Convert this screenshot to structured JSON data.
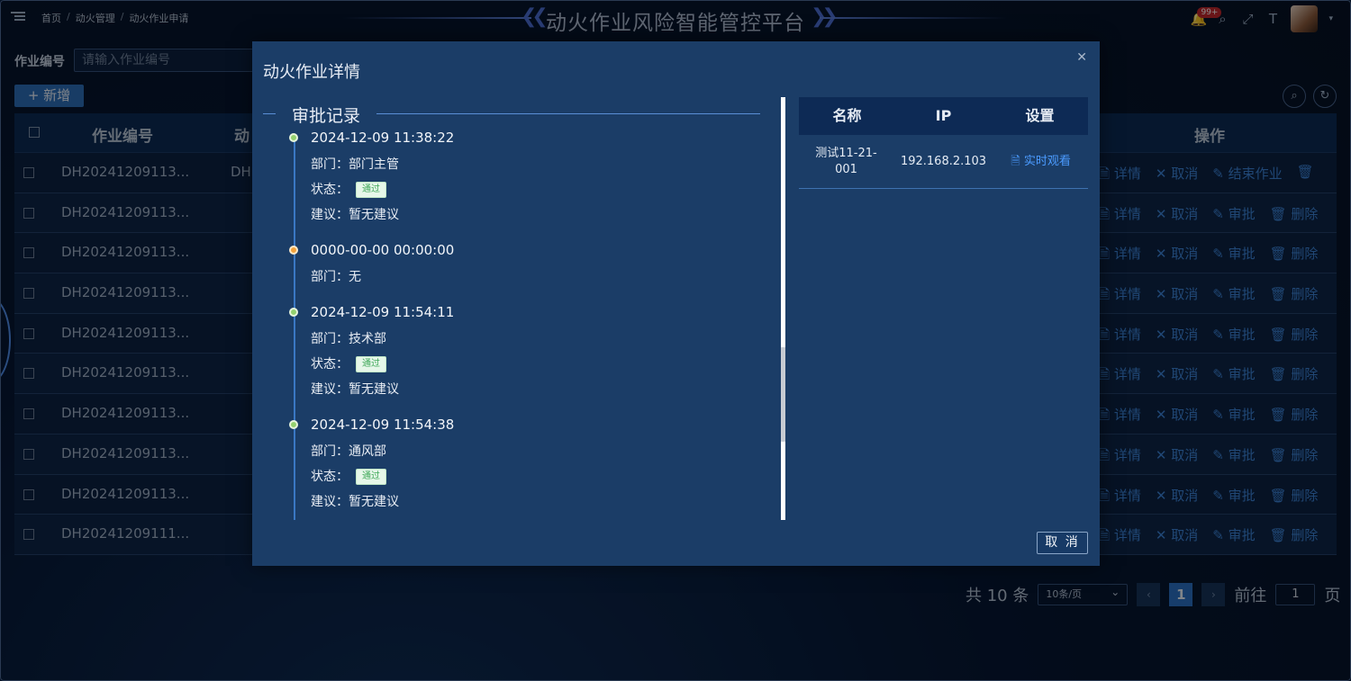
{
  "breadcrumb": [
    "首页",
    "动火管理",
    "动火作业申请"
  ],
  "breadcrumb_sep": "/",
  "app_title": "动火作业风险智能管控平台",
  "notification_badge": "99+",
  "filter": {
    "label": "作业编号",
    "placeholder": "请输入作业编号"
  },
  "add_button": "+ 新增",
  "table": {
    "headers": {
      "code": "作业编号",
      "partial": "动",
      "ops": "操作"
    },
    "rows": [
      {
        "code": "DH20241209113...",
        "partial": "DH",
        "ops": [
          "详情",
          "取消",
          "结束作业",
          ""
        ]
      },
      {
        "code": "DH20241209113...",
        "partial": "",
        "ops": [
          "详情",
          "取消",
          "审批",
          "删除"
        ]
      },
      {
        "code": "DH20241209113...",
        "partial": "",
        "ops": [
          "详情",
          "取消",
          "审批",
          "删除"
        ]
      },
      {
        "code": "DH20241209113...",
        "partial": "",
        "ops": [
          "详情",
          "取消",
          "审批",
          "删除"
        ]
      },
      {
        "code": "DH20241209113...",
        "partial": "",
        "ops": [
          "详情",
          "取消",
          "审批",
          "删除"
        ]
      },
      {
        "code": "DH20241209113...",
        "partial": "",
        "ops": [
          "详情",
          "取消",
          "审批",
          "删除"
        ]
      },
      {
        "code": "DH20241209113...",
        "partial": "",
        "ops": [
          "详情",
          "取消",
          "审批",
          "删除"
        ]
      },
      {
        "code": "DH20241209113...",
        "partial": "",
        "ops": [
          "详情",
          "取消",
          "审批",
          "删除"
        ]
      },
      {
        "code": "DH20241209113...",
        "partial": "",
        "ops": [
          "详情",
          "取消",
          "审批",
          "删除"
        ]
      },
      {
        "code": "DH20241209111...",
        "partial": "",
        "ops": [
          "详情",
          "取消",
          "审批",
          "删除"
        ]
      }
    ]
  },
  "pagination": {
    "total": "共 10 条",
    "page_size": "10条/页",
    "current": "1",
    "goto_label": "前往",
    "goto_value": "1",
    "page_suffix": "页"
  },
  "modal": {
    "title": "动火作业详情",
    "section_title": "审批记录",
    "labels": {
      "dept": "部门：",
      "status": "状态：",
      "advice": "建议："
    },
    "records": [
      {
        "time": "2024-12-09 11:38:22",
        "dept": "部门主管",
        "status": "通过",
        "advice": "暂无建议",
        "dot": "green"
      },
      {
        "time": "0000-00-00 00:00:00",
        "dept": "无",
        "status": "",
        "advice": "",
        "dot": "orange"
      },
      {
        "time": "2024-12-09 11:54:11",
        "dept": "技术部",
        "status": "通过",
        "advice": "暂无建议",
        "dot": "green"
      },
      {
        "time": "2024-12-09 11:54:38",
        "dept": "通风部",
        "status": "通过",
        "advice": "暂无建议",
        "dot": "green"
      }
    ],
    "camera_table": {
      "headers": [
        "名称",
        "IP",
        "设置"
      ],
      "rows": [
        {
          "name": "测试11-21-001",
          "ip": "192.168.2.103",
          "action": "实时观看"
        }
      ]
    },
    "cancel_button": "取 消"
  }
}
